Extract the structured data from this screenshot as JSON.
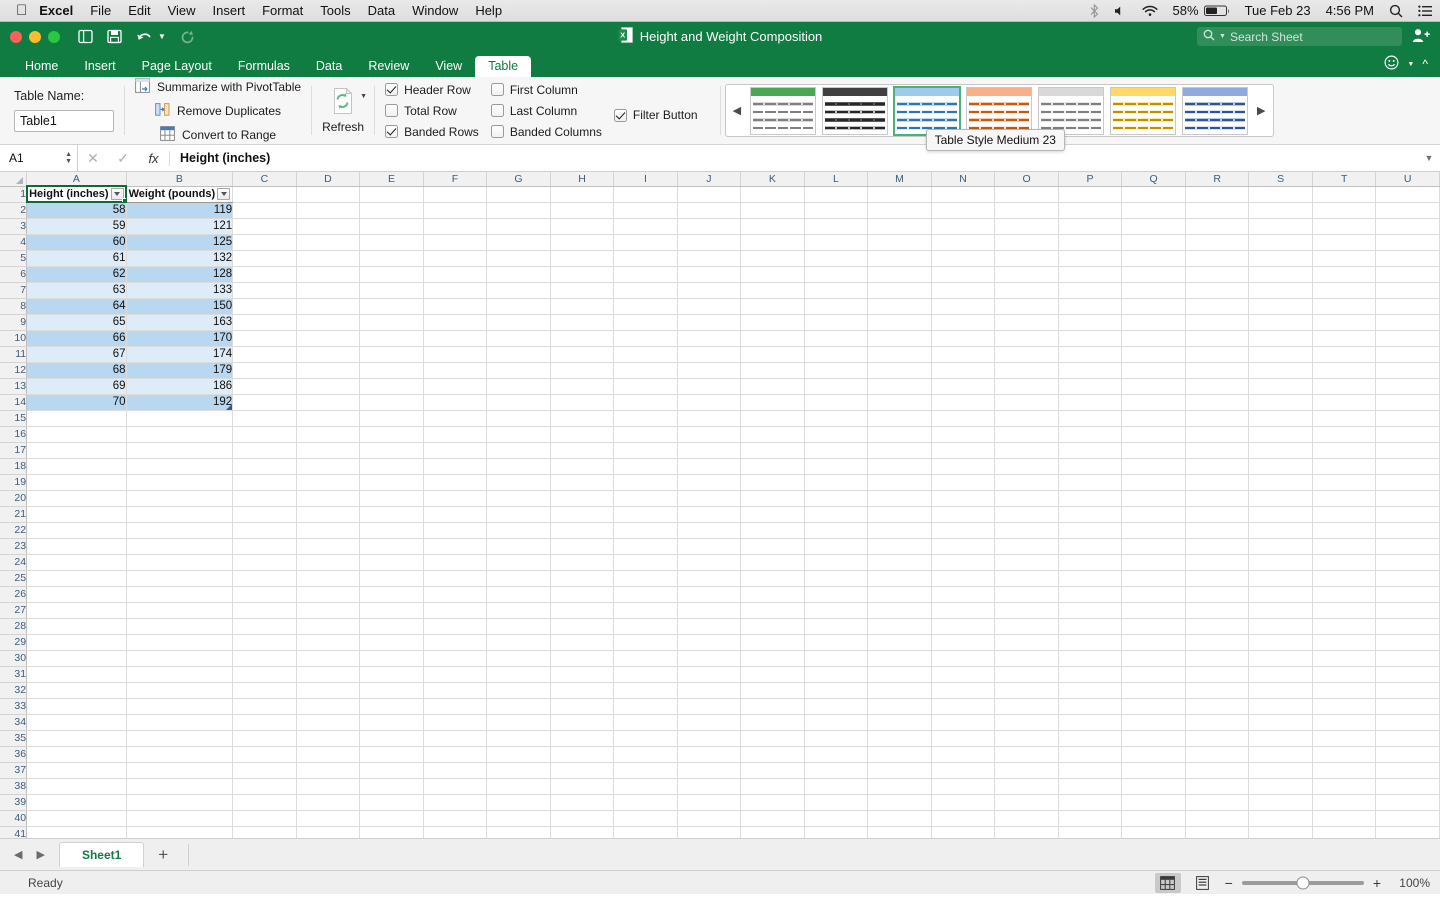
{
  "menubar": {
    "apple": "apple-logo",
    "items": [
      "Excel",
      "File",
      "Edit",
      "View",
      "Insert",
      "Format",
      "Tools",
      "Data",
      "Window",
      "Help"
    ],
    "battery_pct": "58%",
    "date": "Tue Feb 23",
    "time": "4:56 PM"
  },
  "titlebar": {
    "document_title": "Height and Weight Composition",
    "search_placeholder": "Search Sheet"
  },
  "ribbon_tabs": {
    "items": [
      "Home",
      "Insert",
      "Page Layout",
      "Formulas",
      "Data",
      "Review",
      "View",
      "Table"
    ],
    "active": "Table"
  },
  "ribbon": {
    "table_name_label": "Table Name:",
    "table_name_value": "Table1",
    "tools": [
      "Summarize with PivotTable",
      "Remove Duplicates",
      "Convert to Range"
    ],
    "refresh_label": "Refresh",
    "options": [
      {
        "label": "Header Row",
        "checked": true
      },
      {
        "label": "Total Row",
        "checked": false
      },
      {
        "label": "Banded Rows",
        "checked": true
      },
      {
        "label": "First Column",
        "checked": false
      },
      {
        "label": "Last Column",
        "checked": false
      },
      {
        "label": "Banded Columns",
        "checked": false
      },
      {
        "label": "Filter Button",
        "checked": true
      }
    ],
    "gallery": {
      "tooltip": "Table Style Medium 23",
      "selected_index": 2,
      "styles": [
        {
          "header": "#4aa754",
          "band_a": "#d9d9d9",
          "band_b": "#ffffff",
          "line": "#7f7f7f",
          "border": "#ffffff"
        },
        {
          "header": "#404040",
          "band_a": "#595959",
          "band_b": "#bfbfbf",
          "line": "#262626",
          "border": "#000000"
        },
        {
          "header": "#9ecbea",
          "band_a": "#bcdcf2",
          "band_b": "#e3f0fa",
          "line": "#2e75b6",
          "border": "#9ecbea"
        },
        {
          "header": "#f8b08a",
          "band_a": "#fac5a8",
          "band_b": "#fde4d6",
          "line": "#c55a11",
          "border": "#f8b08a"
        },
        {
          "header": "#d9d9d9",
          "band_a": "#e6e6e6",
          "band_b": "#f5f5f5",
          "line": "#808080",
          "border": "#d9d9d9"
        },
        {
          "header": "#ffd966",
          "band_a": "#ffe699",
          "band_b": "#fff2cc",
          "line": "#bf8f00",
          "border": "#ffd966"
        },
        {
          "header": "#8faadc",
          "band_a": "#b4c7e7",
          "band_b": "#d9e2f3",
          "line": "#2f5597",
          "border": "#8faadc"
        }
      ]
    }
  },
  "formula_bar": {
    "name_box": "A1",
    "content": "Height (inches)"
  },
  "grid": {
    "column_headers": [
      "A",
      "B",
      "C",
      "D",
      "E",
      "F",
      "G",
      "H",
      "I",
      "J",
      "K",
      "L",
      "M",
      "N",
      "O",
      "P",
      "Q",
      "R",
      "S",
      "T",
      "U"
    ],
    "row_count": 41,
    "table_headers": [
      "Height (inches)",
      "Weight (pounds)"
    ],
    "table_rows": [
      [
        "58",
        "119"
      ],
      [
        "59",
        "121"
      ],
      [
        "60",
        "125"
      ],
      [
        "61",
        "132"
      ],
      [
        "62",
        "128"
      ],
      [
        "63",
        "133"
      ],
      [
        "64",
        "150"
      ],
      [
        "65",
        "163"
      ],
      [
        "66",
        "170"
      ],
      [
        "67",
        "174"
      ],
      [
        "68",
        "179"
      ],
      [
        "69",
        "186"
      ],
      [
        "70",
        "192"
      ]
    ]
  },
  "sheetbar": {
    "sheets": [
      "Sheet1"
    ],
    "active_sheet": "Sheet1"
  },
  "statusbar": {
    "status": "Ready",
    "zoom": "100%"
  }
}
